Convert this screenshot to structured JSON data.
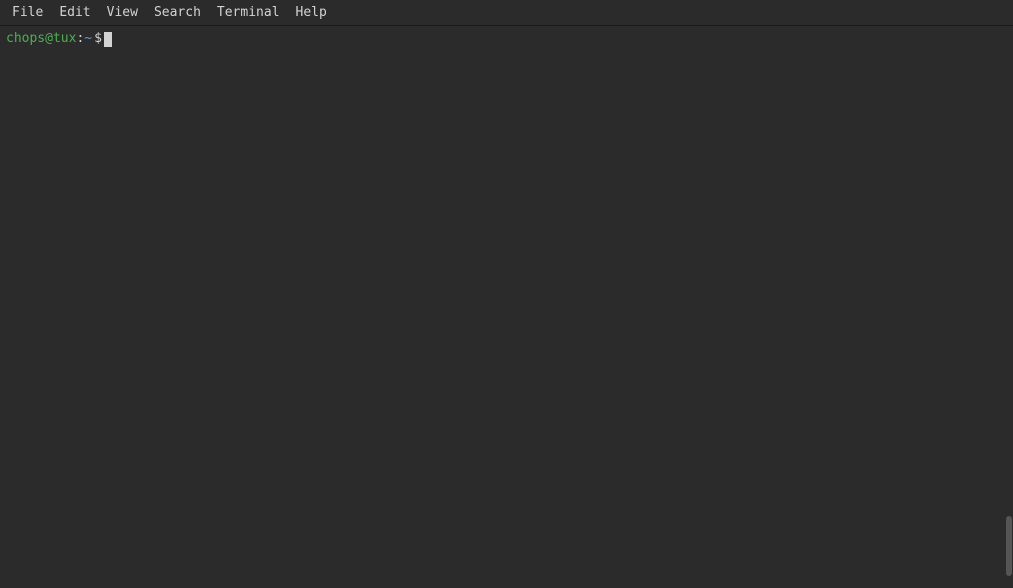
{
  "menubar": {
    "items": [
      {
        "id": "file",
        "label": "File"
      },
      {
        "id": "edit",
        "label": "Edit"
      },
      {
        "id": "view",
        "label": "View"
      },
      {
        "id": "search",
        "label": "Search"
      },
      {
        "id": "terminal",
        "label": "Terminal"
      },
      {
        "id": "help",
        "label": "Help"
      }
    ]
  },
  "terminal": {
    "prompt": {
      "user_host": "chops@tux",
      "separator": ":",
      "path": "~",
      "dollar": "$"
    }
  }
}
